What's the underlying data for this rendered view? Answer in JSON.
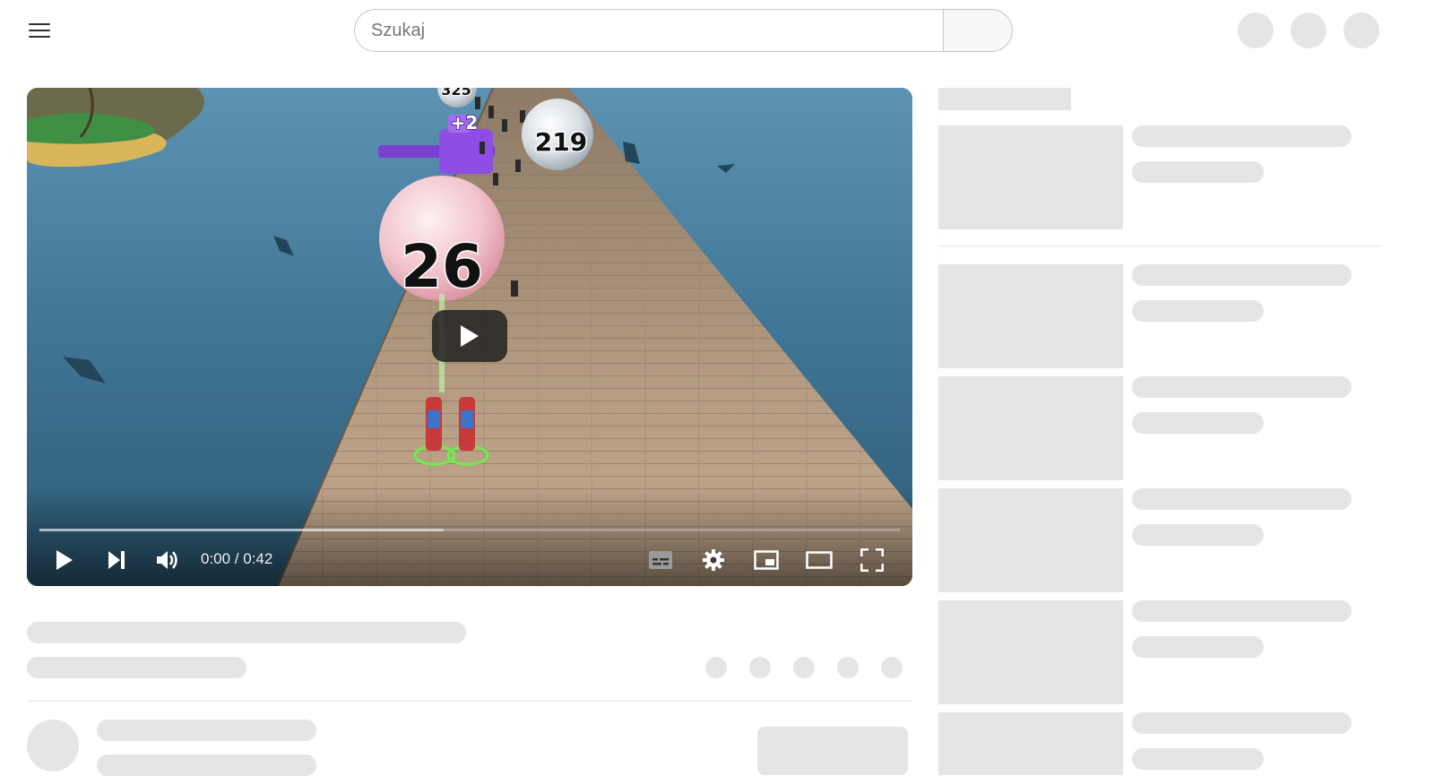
{
  "header": {
    "search_placeholder": "Szukaj"
  },
  "player": {
    "time_display": "0:00 / 0:42",
    "progress_current": 0,
    "progress_loaded_fraction": 0.47,
    "scene_labels": {
      "bubble_large": "26",
      "bubble_right": "219",
      "bubble_top": "325",
      "bonus": "+2"
    }
  },
  "icons": {
    "menu": "menu-icon",
    "play": "play-icon",
    "next": "next-icon",
    "volume": "volume-icon",
    "subtitles": "subtitles-icon",
    "settings": "gear-icon",
    "miniplayer": "miniplayer-icon",
    "theater": "theater-mode-icon",
    "fullscreen": "fullscreen-icon"
  },
  "colors": {
    "skeleton": "#e5e5e5",
    "player_controls": "#ffffff"
  }
}
